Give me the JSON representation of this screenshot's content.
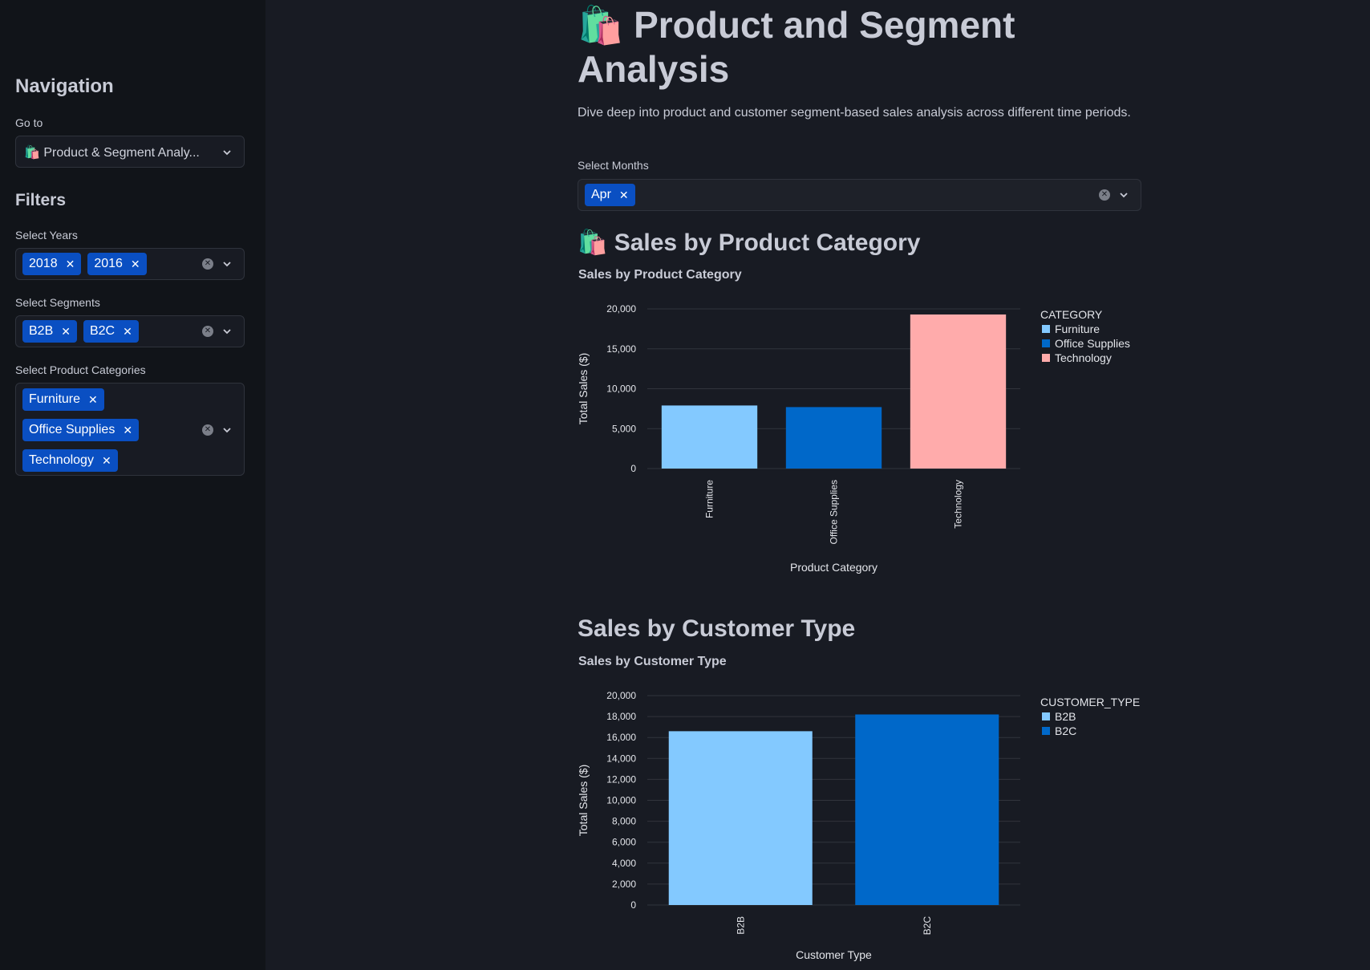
{
  "sidebar": {
    "navigation_title": "Navigation",
    "goto_label": "Go to",
    "goto_emoji": "🛍️",
    "goto_value": "Product & Segment Analy...",
    "filters_title": "Filters",
    "years": {
      "label": "Select Years",
      "selected": [
        "2018",
        "2016"
      ]
    },
    "segments": {
      "label": "Select Segments",
      "selected": [
        "B2B",
        "B2C"
      ]
    },
    "categories": {
      "label": "Select Product Categories",
      "selected": [
        "Furniture",
        "Office Supplies",
        "Technology"
      ]
    }
  },
  "main": {
    "title_emoji": "🛍️",
    "title": "Product and Segment Analysis",
    "description": "Dive deep into product and customer segment-based sales analysis across different time periods.",
    "months": {
      "label": "Select Months",
      "selected": [
        "Apr"
      ]
    },
    "section1": {
      "emoji": "🛍️",
      "heading": "Sales by Product Category"
    },
    "section2": {
      "heading": "Sales by Customer Type"
    }
  },
  "colors": {
    "accent_tag": "#0a4fc2",
    "light_blue": "#83c9ff",
    "dark_blue": "#0068c9",
    "pink": "#ffabab"
  },
  "chart_data": [
    {
      "type": "bar",
      "title": "Sales by Product Category",
      "xlabel": "Product Category",
      "ylabel": "Total Sales ($)",
      "categories": [
        "Furniture",
        "Office Supplies",
        "Technology"
      ],
      "values": [
        7900,
        7700,
        19300
      ],
      "colors": [
        "#83c9ff",
        "#0068c9",
        "#ffabab"
      ],
      "ylim": [
        0,
        20000
      ],
      "yticks": [
        0,
        5000,
        10000,
        15000,
        20000
      ],
      "ytick_labels": [
        "0",
        "5,000",
        "10,000",
        "15,000",
        "20,000"
      ],
      "legend_title": "CATEGORY",
      "legend": [
        "Furniture",
        "Office Supplies",
        "Technology"
      ],
      "legend_position": "right",
      "grid": true
    },
    {
      "type": "bar",
      "title": "Sales by Customer Type",
      "xlabel": "Customer Type",
      "ylabel": "Total Sales ($)",
      "categories": [
        "B2B",
        "B2C"
      ],
      "values": [
        16600,
        18200
      ],
      "colors": [
        "#83c9ff",
        "#0068c9"
      ],
      "ylim": [
        0,
        20000
      ],
      "yticks": [
        0,
        2000,
        4000,
        6000,
        8000,
        10000,
        12000,
        14000,
        16000,
        18000,
        20000
      ],
      "ytick_labels": [
        "0",
        "2,000",
        "4,000",
        "6,000",
        "8,000",
        "10,000",
        "12,000",
        "14,000",
        "16,000",
        "18,000",
        "20,000"
      ],
      "legend_title": "CUSTOMER_TYPE",
      "legend": [
        "B2B",
        "B2C"
      ],
      "legend_position": "right",
      "grid": true
    }
  ]
}
